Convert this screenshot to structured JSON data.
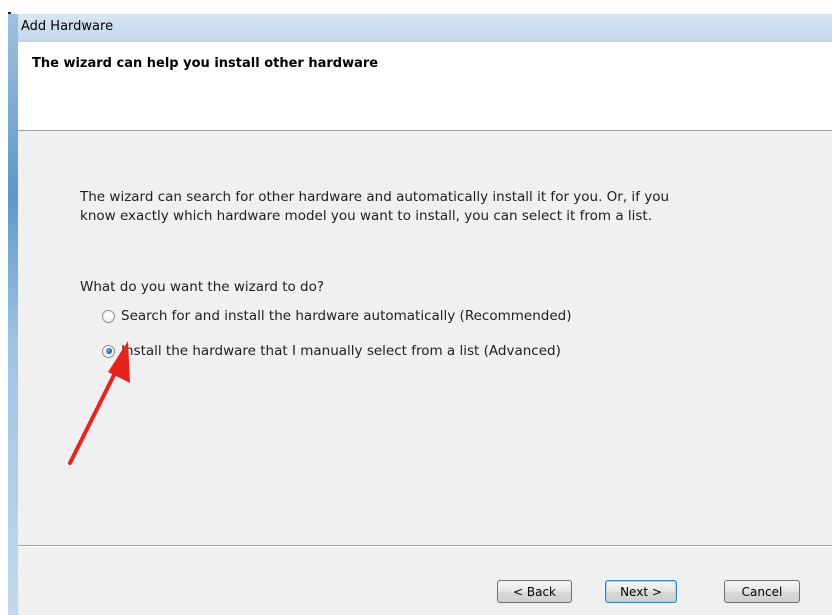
{
  "window": {
    "title": "Add Hardware"
  },
  "header": {
    "title": "The wizard can help you install other hardware"
  },
  "content": {
    "intro_line1": "The wizard can search for other hardware and automatically install it for you. Or, if you",
    "intro_line2": "know exactly which hardware model you want to install, you can select it from a list.",
    "question": "What do you want the wizard to do?",
    "options": [
      {
        "label": "Search for and install the hardware automatically (Recommended)",
        "selected": false
      },
      {
        "label": "Install the hardware that I manually select from a list (Advanced)",
        "selected": true
      }
    ]
  },
  "annotation": {
    "icon": "red-arrow-icon",
    "color": "#e8221f"
  },
  "buttons": {
    "back": "< Back",
    "next": "Next >",
    "cancel": "Cancel"
  }
}
